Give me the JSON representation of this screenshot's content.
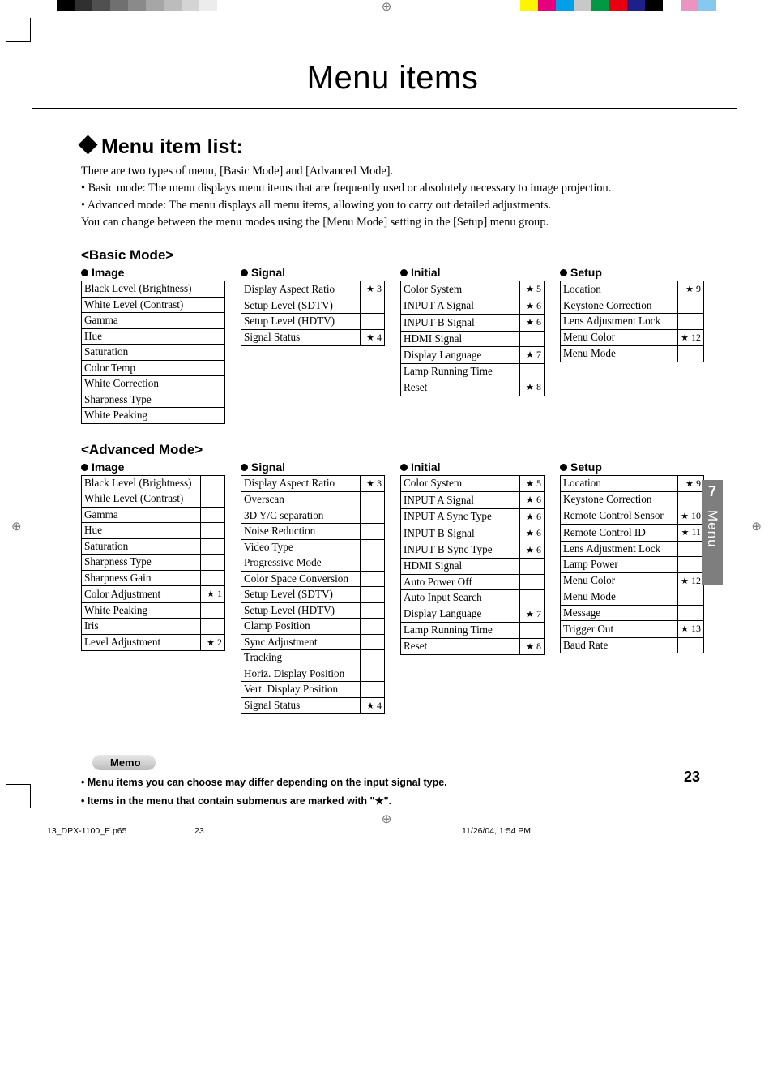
{
  "page_title": "Menu items",
  "section_heading": "Menu item list:",
  "intro": [
    "There are two types of menu, [Basic Mode] and [Advanced Mode].",
    "• Basic mode: The menu displays menu items that are frequently used or absolutely necessary to image projection.",
    "• Advanced mode: The menu displays all menu items, allowing you to carry out detailed adjustments.",
    "You can change between the menu modes using the [Menu Mode] setting in the [Setup] menu group."
  ],
  "modes": {
    "basic": {
      "title": "<Basic Mode>",
      "groups": [
        {
          "name": "Image",
          "items": [
            {
              "label": "Black Level (Brightness)"
            },
            {
              "label": "White Level (Contrast)"
            },
            {
              "label": "Gamma"
            },
            {
              "label": "Hue"
            },
            {
              "label": "Saturation"
            },
            {
              "label": "Color Temp"
            },
            {
              "label": "White Correction"
            },
            {
              "label": "Sharpness Type"
            },
            {
              "label": "White Peaking"
            }
          ]
        },
        {
          "name": "Signal",
          "items": [
            {
              "label": "Display Aspect Ratio",
              "star": 3
            },
            {
              "label": "Setup Level (SDTV)"
            },
            {
              "label": "Setup Level (HDTV)"
            },
            {
              "label": "Signal Status",
              "star": 4
            }
          ]
        },
        {
          "name": "Initial",
          "items": [
            {
              "label": "Color System",
              "star": 5
            },
            {
              "label": "INPUT A Signal",
              "star": 6
            },
            {
              "label": "INPUT B Signal",
              "star": 6
            },
            {
              "label": "HDMI Signal"
            },
            {
              "label": "Display Language",
              "star": 7
            },
            {
              "label": "Lamp Running Time"
            },
            {
              "label": "Reset",
              "star": 8
            }
          ]
        },
        {
          "name": "Setup",
          "items": [
            {
              "label": "Location",
              "star": 9
            },
            {
              "label": "Keystone Correction"
            },
            {
              "label": "Lens Adjustment Lock"
            },
            {
              "label": "Menu Color",
              "star": 12
            },
            {
              "label": "Menu Mode"
            }
          ]
        }
      ]
    },
    "advanced": {
      "title": "<Advanced Mode>",
      "groups": [
        {
          "name": "Image",
          "items": [
            {
              "label": "Black Level (Brightness)"
            },
            {
              "label": "While Level (Contrast)"
            },
            {
              "label": "Gamma"
            },
            {
              "label": "Hue"
            },
            {
              "label": "Saturation"
            },
            {
              "label": "Sharpness Type"
            },
            {
              "label": "Sharpness Gain"
            },
            {
              "label": "Color Adjustment",
              "star": 1
            },
            {
              "label": "White Peaking"
            },
            {
              "label": "Iris"
            },
            {
              "label": "Level Adjustment",
              "star": 2
            }
          ]
        },
        {
          "name": "Signal",
          "items": [
            {
              "label": "Display Aspect Ratio",
              "star": 3
            },
            {
              "label": "Overscan"
            },
            {
              "label": "3D Y/C separation"
            },
            {
              "label": "Noise Reduction"
            },
            {
              "label": "Video Type"
            },
            {
              "label": "Progressive Mode"
            },
            {
              "label": "Color Space Conversion"
            },
            {
              "label": "Setup Level (SDTV)"
            },
            {
              "label": "Setup Level (HDTV)"
            },
            {
              "label": "Clamp Position"
            },
            {
              "label": "Sync Adjustment"
            },
            {
              "label": "Tracking"
            },
            {
              "label": "Horiz. Display Position"
            },
            {
              "label": "Vert. Display Position"
            },
            {
              "label": "Signal Status",
              "star": 4
            }
          ]
        },
        {
          "name": "Initial",
          "items": [
            {
              "label": "Color System",
              "star": 5
            },
            {
              "label": "INPUT A Signal",
              "star": 6
            },
            {
              "label": "INPUT A Sync Type",
              "star": 6
            },
            {
              "label": "INPUT B Signal",
              "star": 6
            },
            {
              "label": "INPUT B Sync Type",
              "star": 6
            },
            {
              "label": "HDMI Signal"
            },
            {
              "label": "Auto Power Off"
            },
            {
              "label": "Auto Input Search"
            },
            {
              "label": "Display Language",
              "star": 7
            },
            {
              "label": "Lamp Running Time"
            },
            {
              "label": "Reset",
              "star": 8
            }
          ]
        },
        {
          "name": "Setup",
          "items": [
            {
              "label": "Location",
              "star": 9
            },
            {
              "label": "Keystone Correction"
            },
            {
              "label": "Remote Control Sensor",
              "star": 10
            },
            {
              "label": "Remote Control ID",
              "star": 11
            },
            {
              "label": "Lens Adjustment Lock"
            },
            {
              "label": "Lamp Power"
            },
            {
              "label": "Menu Color",
              "star": 12
            },
            {
              "label": "Menu Mode"
            },
            {
              "label": "Message"
            },
            {
              "label": "Trigger Out",
              "star": 13
            },
            {
              "label": "Baud Rate"
            }
          ]
        }
      ]
    }
  },
  "memo": {
    "label": "Memo",
    "lines": [
      "• Menu items you can choose may differ depending on the input signal type.",
      "• Items in the menu that contain submenus are marked with \"★\"."
    ]
  },
  "side_tab": {
    "chapter": "7",
    "label": "Menu"
  },
  "page_number": "23",
  "footer": {
    "file": "13_DPX-1100_E.p65",
    "page": "23",
    "date": "11/26/04, 1:54 PM"
  },
  "swatches_left": [
    "#000",
    "#303030",
    "#505050",
    "#707070",
    "#8a8a8a",
    "#a6a6a6",
    "#bcbcbc",
    "#d4d4d4",
    "#ececec",
    "#fff"
  ],
  "swatches_right": [
    "#fff500",
    "#e4007f",
    "#00a0e9",
    "#c8c8c8",
    "#009944",
    "#e60012",
    "#1d2088",
    "#000",
    "#fff",
    "#e995c0",
    "#87c9ee"
  ]
}
